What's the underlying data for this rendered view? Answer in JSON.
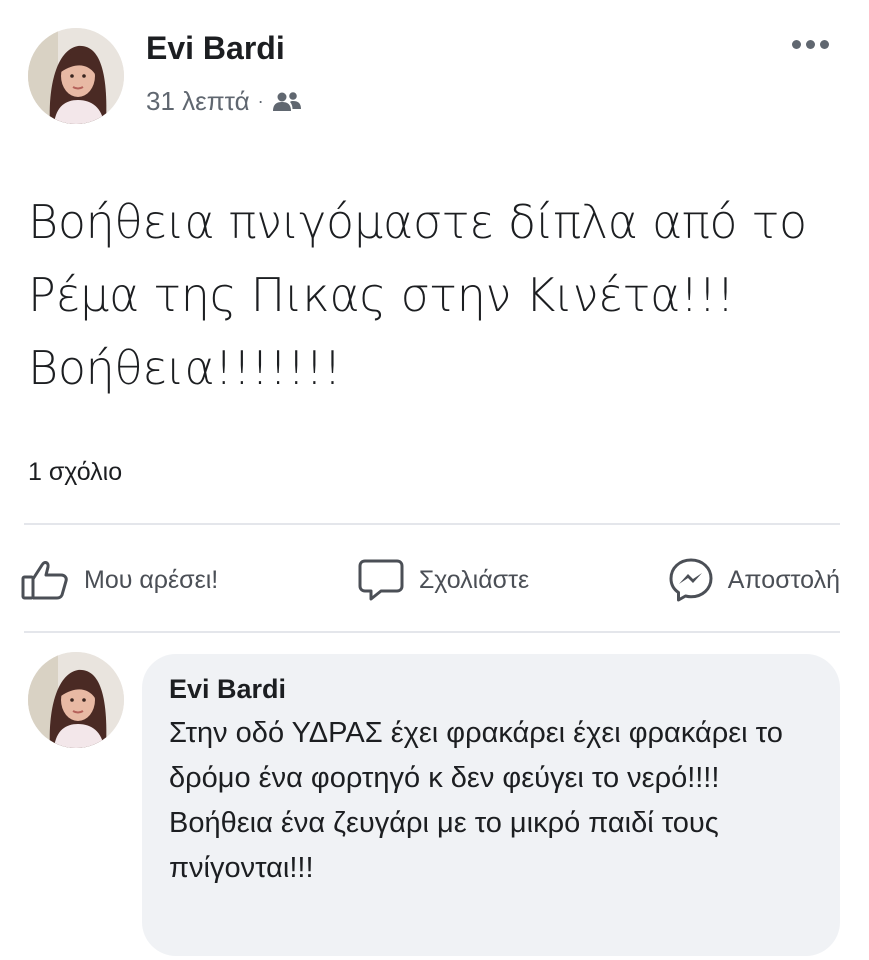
{
  "post": {
    "author": "Evi Bardi",
    "time": "31 λεπτά",
    "separator": "·",
    "privacy_icon": "friends-icon",
    "more_icon": "more-horizontal-icon",
    "text": "Βοήθεια πνιγόμαστε δίπλα από το Ρέμα της Πικας στην Κινέτα!!! Βοήθεια!!!!!!!",
    "comment_count": "1 σχόλιο"
  },
  "actions": {
    "like": {
      "label": "Μου αρέσει!",
      "icon": "thumbs-up-icon"
    },
    "comment": {
      "label": "Σχολιάστε",
      "icon": "comment-bubble-icon"
    },
    "send": {
      "label": "Αποστολή",
      "icon": "messenger-icon"
    }
  },
  "comment": {
    "author": "Evi Bardi",
    "text": "Στην οδό ΥΔΡΑΣ έχει φρακάρει έχει φρακάρει το δρόμο ένα φορτηγό κ δεν φεύγει το νερό!!!! Βοήθεια ένα ζευγάρι με το μικρό παιδί τους πνίγονται!!!"
  },
  "colors": {
    "text_primary": "#1c1e21",
    "text_secondary": "#606770",
    "bubble_bg": "#f0f2f5",
    "divider": "#e4e6eb"
  }
}
